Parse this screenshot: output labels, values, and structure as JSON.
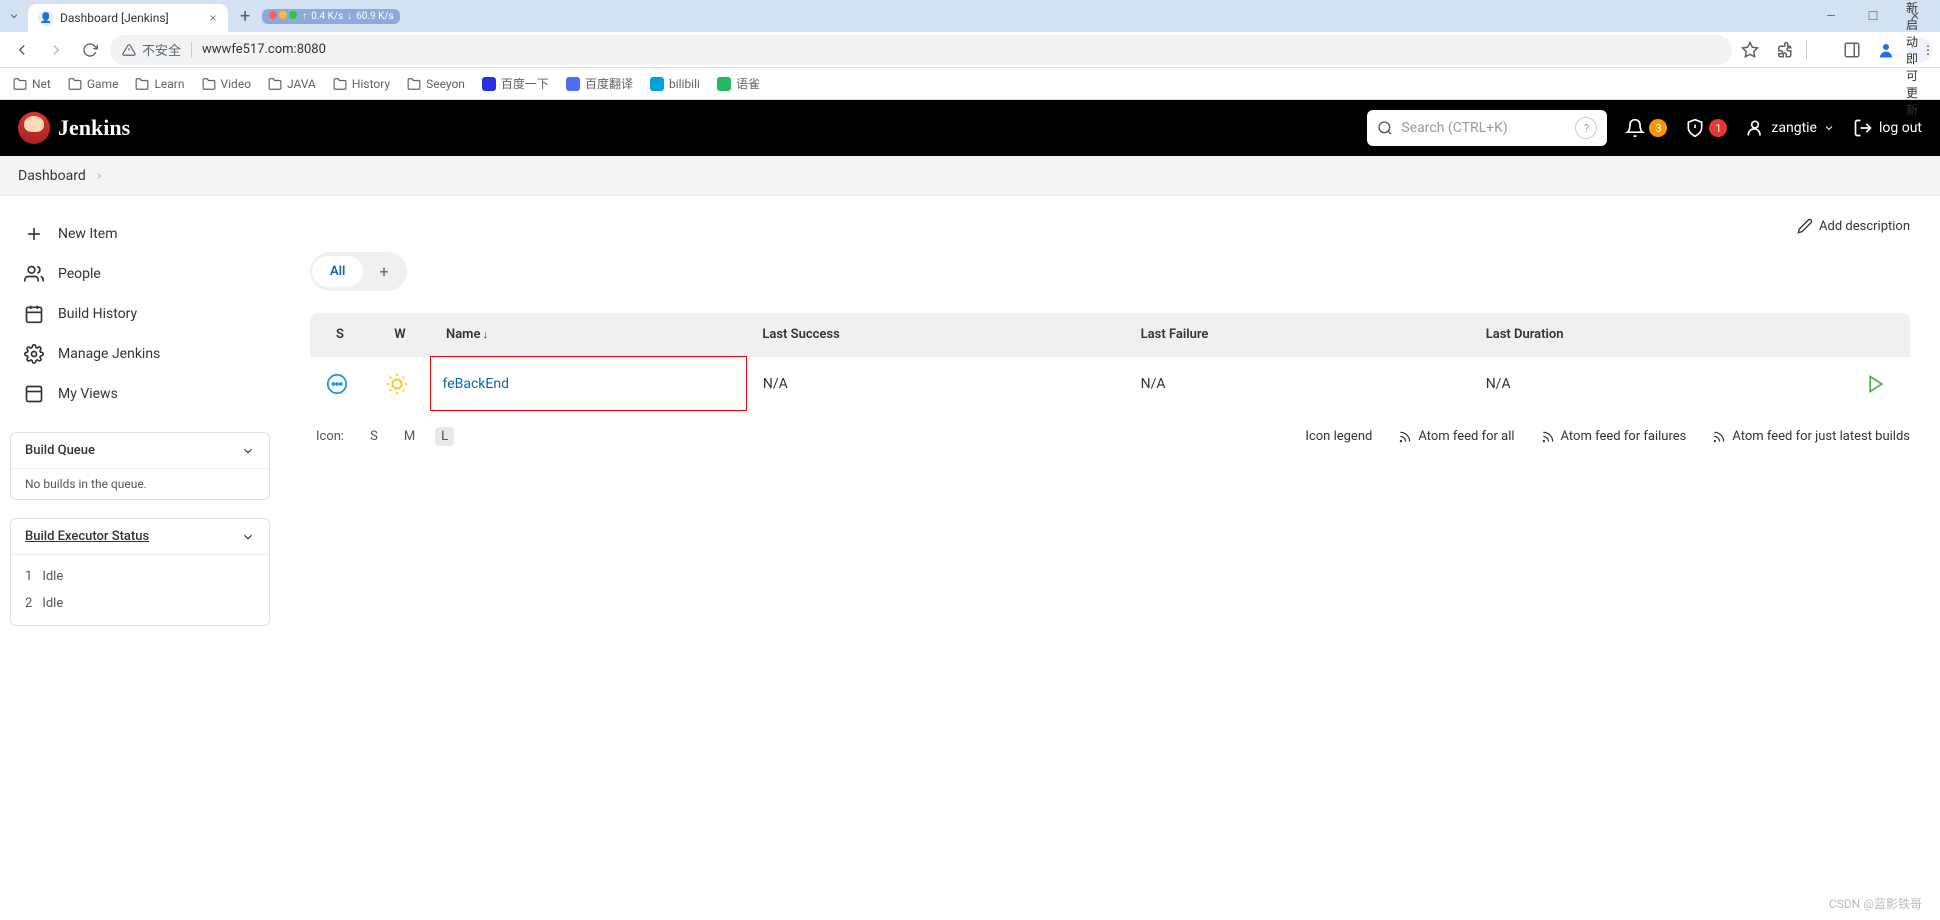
{
  "browser": {
    "tab_title": "Dashboard [Jenkins]",
    "url": "wwwfe517.com:8080",
    "insecure_label": "不安全",
    "restart_label": "重新启动即可更新",
    "net_up": "0.4 K/s",
    "net_down": "60.9 K/s"
  },
  "bookmarks": [
    {
      "label": "Net",
      "type": "folder"
    },
    {
      "label": "Game",
      "type": "folder"
    },
    {
      "label": "Learn",
      "type": "folder"
    },
    {
      "label": "Video",
      "type": "folder"
    },
    {
      "label": "JAVA",
      "type": "folder"
    },
    {
      "label": "History",
      "type": "folder"
    },
    {
      "label": "Seeyon",
      "type": "folder"
    },
    {
      "label": "百度一下",
      "type": "site",
      "color": "#2932e1"
    },
    {
      "label": "百度翻译",
      "type": "site",
      "color": "#4e6ef2"
    },
    {
      "label": "bilibili",
      "type": "site",
      "color": "#00a1d6"
    },
    {
      "label": "语雀",
      "type": "site",
      "color": "#25b864"
    }
  ],
  "header": {
    "brand": "Jenkins",
    "search_placeholder": "Search (CTRL+K)",
    "notif_count": "3",
    "alert_count": "1",
    "user": "zangtie",
    "logout": "log out"
  },
  "breadcrumb": {
    "dashboard": "Dashboard"
  },
  "sidebar": {
    "items": [
      {
        "label": "New Item"
      },
      {
        "label": "People"
      },
      {
        "label": "Build History"
      },
      {
        "label": "Manage Jenkins"
      },
      {
        "label": "My Views"
      }
    ]
  },
  "panels": {
    "queue": {
      "title": "Build Queue",
      "empty": "No builds in the queue."
    },
    "executors": {
      "title": "Build Executor Status",
      "rows": [
        {
          "num": "1",
          "state": "Idle"
        },
        {
          "num": "2",
          "state": "Idle"
        }
      ]
    }
  },
  "main": {
    "add_description": "Add description",
    "tabs": {
      "all": "All"
    },
    "columns": {
      "s": "S",
      "w": "W",
      "name": "Name",
      "last_success": "Last Success",
      "last_failure": "Last Failure",
      "last_duration": "Last Duration"
    },
    "jobs": [
      {
        "name": "feBackEnd",
        "last_success": "N/A",
        "last_failure": "N/A",
        "last_duration": "N/A"
      }
    ],
    "footer": {
      "icon_label": "Icon:",
      "sizes": {
        "s": "S",
        "m": "M",
        "l": "L"
      },
      "legend": "Icon legend",
      "feed_all": "Atom feed for all",
      "feed_fail": "Atom feed for failures",
      "feed_latest": "Atom feed for just latest builds"
    }
  },
  "watermark": "CSDN @蓝影铁哥"
}
